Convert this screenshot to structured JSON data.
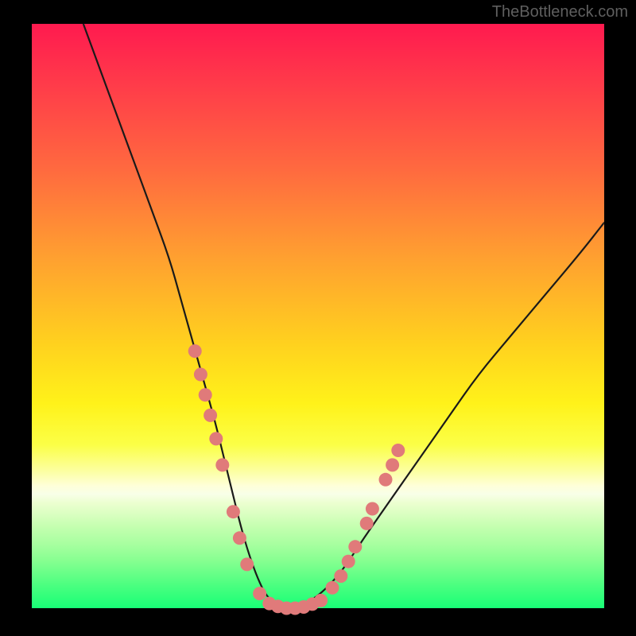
{
  "watermark": "TheBottleneck.com",
  "chart_data": {
    "type": "line",
    "title": "",
    "xlabel": "",
    "ylabel": "",
    "xlim": [
      0,
      100
    ],
    "ylim": [
      0,
      100
    ],
    "legend": false,
    "grid": false,
    "background": "rainbow-gradient-vertical",
    "series": [
      {
        "name": "bottleneck-curve",
        "x": [
          9,
          12,
          15,
          18,
          21,
          24,
          26,
          28,
          30,
          32,
          33.5,
          35,
          36.5,
          38,
          39.5,
          41,
          43,
          45,
          47,
          50,
          54,
          58,
          63,
          68,
          73,
          78,
          84,
          90,
          96,
          100
        ],
        "y": [
          100,
          92,
          84,
          76,
          68,
          60,
          53,
          46,
          39,
          32,
          26,
          20,
          14,
          9,
          5,
          2,
          0.5,
          0,
          0.5,
          2,
          6,
          12,
          19,
          26,
          33,
          40,
          47,
          54,
          61,
          66
        ]
      }
    ],
    "points": [
      {
        "name": "left-cluster",
        "coords": [
          [
            28.5,
            44
          ],
          [
            29.5,
            40
          ],
          [
            30.3,
            36.5
          ],
          [
            31.2,
            33
          ],
          [
            32.2,
            29
          ],
          [
            33.3,
            24.5
          ],
          [
            35.2,
            16.5
          ],
          [
            36.3,
            12
          ],
          [
            37.6,
            7.5
          ],
          [
            39.8,
            2.5
          ]
        ]
      },
      {
        "name": "bottom-cluster",
        "coords": [
          [
            41.5,
            0.8
          ],
          [
            43.0,
            0.3
          ],
          [
            44.5,
            0
          ],
          [
            46.0,
            0
          ],
          [
            47.5,
            0.2
          ],
          [
            49.0,
            0.7
          ],
          [
            50.5,
            1.3
          ]
        ]
      },
      {
        "name": "right-cluster",
        "coords": [
          [
            52.5,
            3.5
          ],
          [
            54.0,
            5.5
          ],
          [
            55.3,
            8.0
          ],
          [
            56.5,
            10.5
          ],
          [
            58.5,
            14.5
          ],
          [
            59.5,
            17
          ],
          [
            61.8,
            22
          ],
          [
            63.0,
            24.5
          ],
          [
            64.0,
            27
          ]
        ]
      }
    ],
    "gradient_stops": [
      {
        "y_pct": 0,
        "color": "#ff1a4f"
      },
      {
        "y_pct": 25,
        "color": "#ff6a3f"
      },
      {
        "y_pct": 55,
        "color": "#ffd21e"
      },
      {
        "y_pct": 79,
        "color": "#feffd8"
      },
      {
        "y_pct": 100,
        "color": "#18ff76"
      }
    ]
  }
}
